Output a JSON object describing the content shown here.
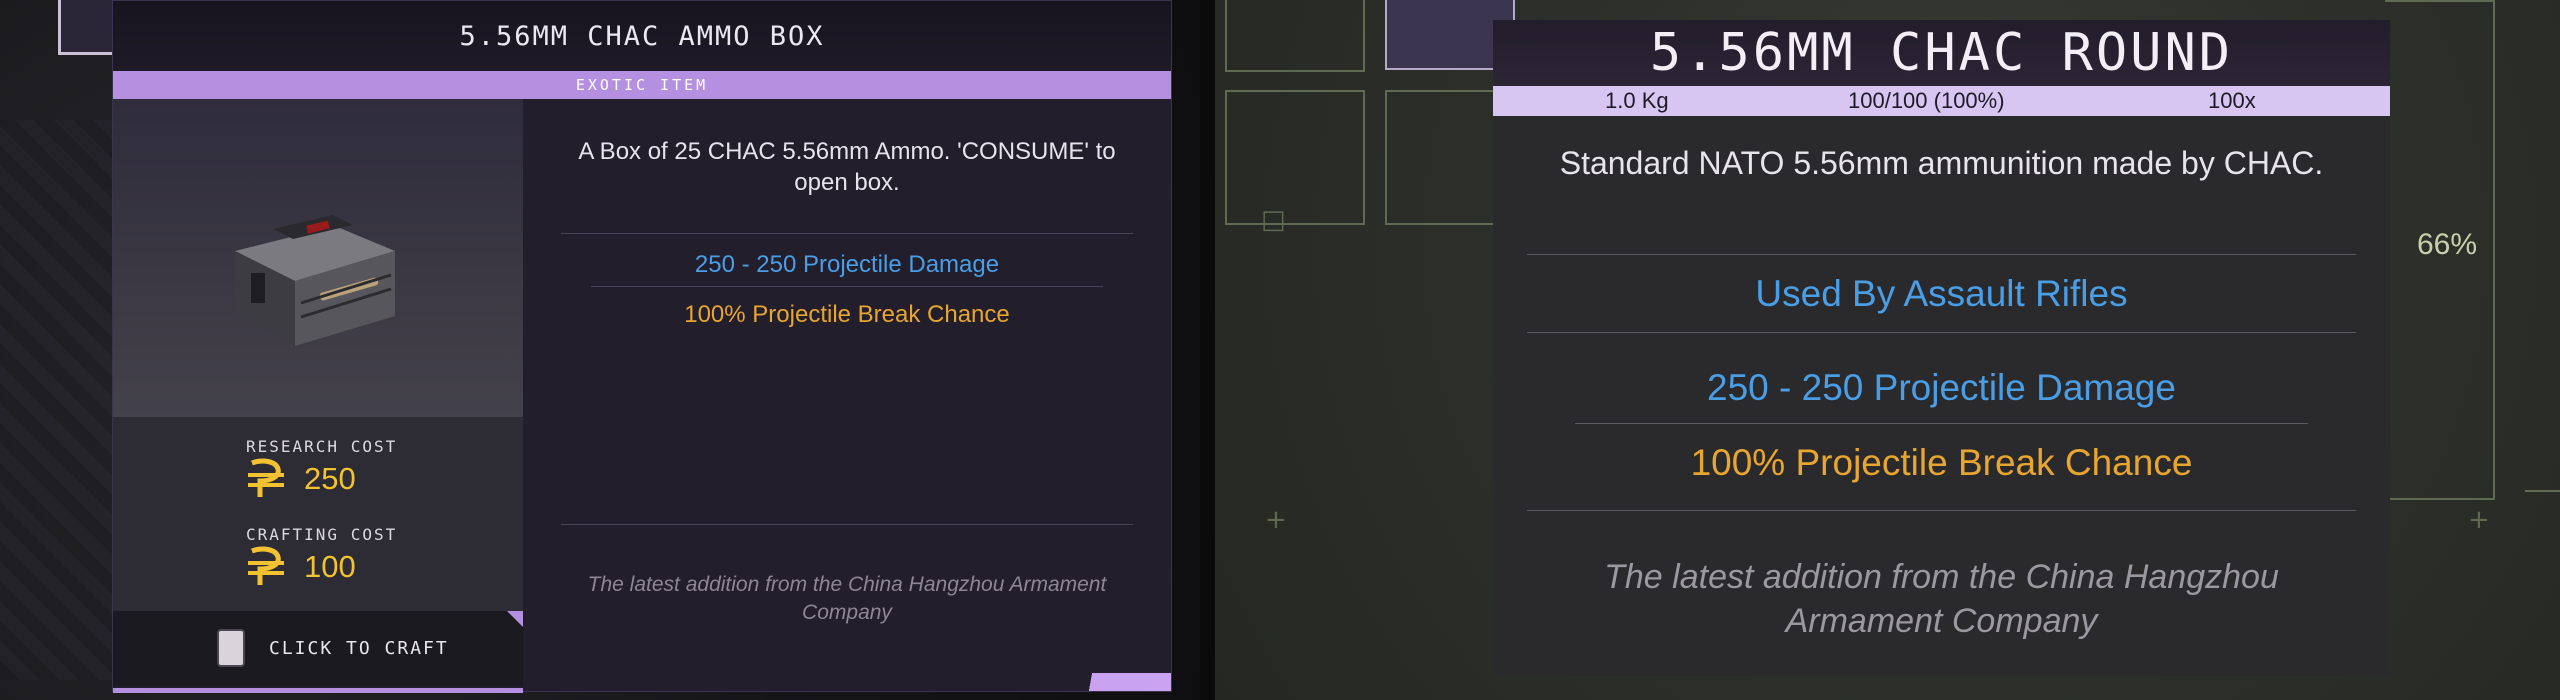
{
  "left_tooltip": {
    "title": "5.56MM CHAC AMMO BOX",
    "rarity": "EXOTIC ITEM",
    "description": "A Box of 25 CHAC 5.56mm Ammo. 'CONSUME' to open box.",
    "damage": "250 - 250 Projectile Damage",
    "break_chance": "100% Projectile Break Chance",
    "flavor": "The latest addition from the China Hangzhou Armament Company",
    "research_cost_label": "RESEARCH COST",
    "research_cost_value": "250",
    "crafting_cost_label": "CRAFTING COST",
    "crafting_cost_value": "100",
    "craft_action": "CLICK TO CRAFT",
    "icons": {
      "item": "ammo-case-icon",
      "currency": "credits-icon",
      "key": "craft-key-icon"
    }
  },
  "right_tooltip": {
    "title": "5.56MM CHAC ROUND",
    "weight": "1.0 Kg",
    "durability": "100/100 (100%)",
    "quantity": "100x",
    "description": "Standard NATO 5.56mm ammunition made by CHAC.",
    "used_by": "Used By Assault Rifles",
    "damage": "250 - 250 Projectile Damage",
    "break_chance": "100% Projectile Break Chance",
    "flavor": "The latest addition from the China Hangzhou Armament Company",
    "percent_indicator": "66%"
  },
  "colors": {
    "exotic_purple": "#b58fe0",
    "damage_blue": "#4a9ee6",
    "break_orange": "#e8a530",
    "cost_yellow": "#f2c230",
    "stat_bar": "#d7c6f2"
  }
}
